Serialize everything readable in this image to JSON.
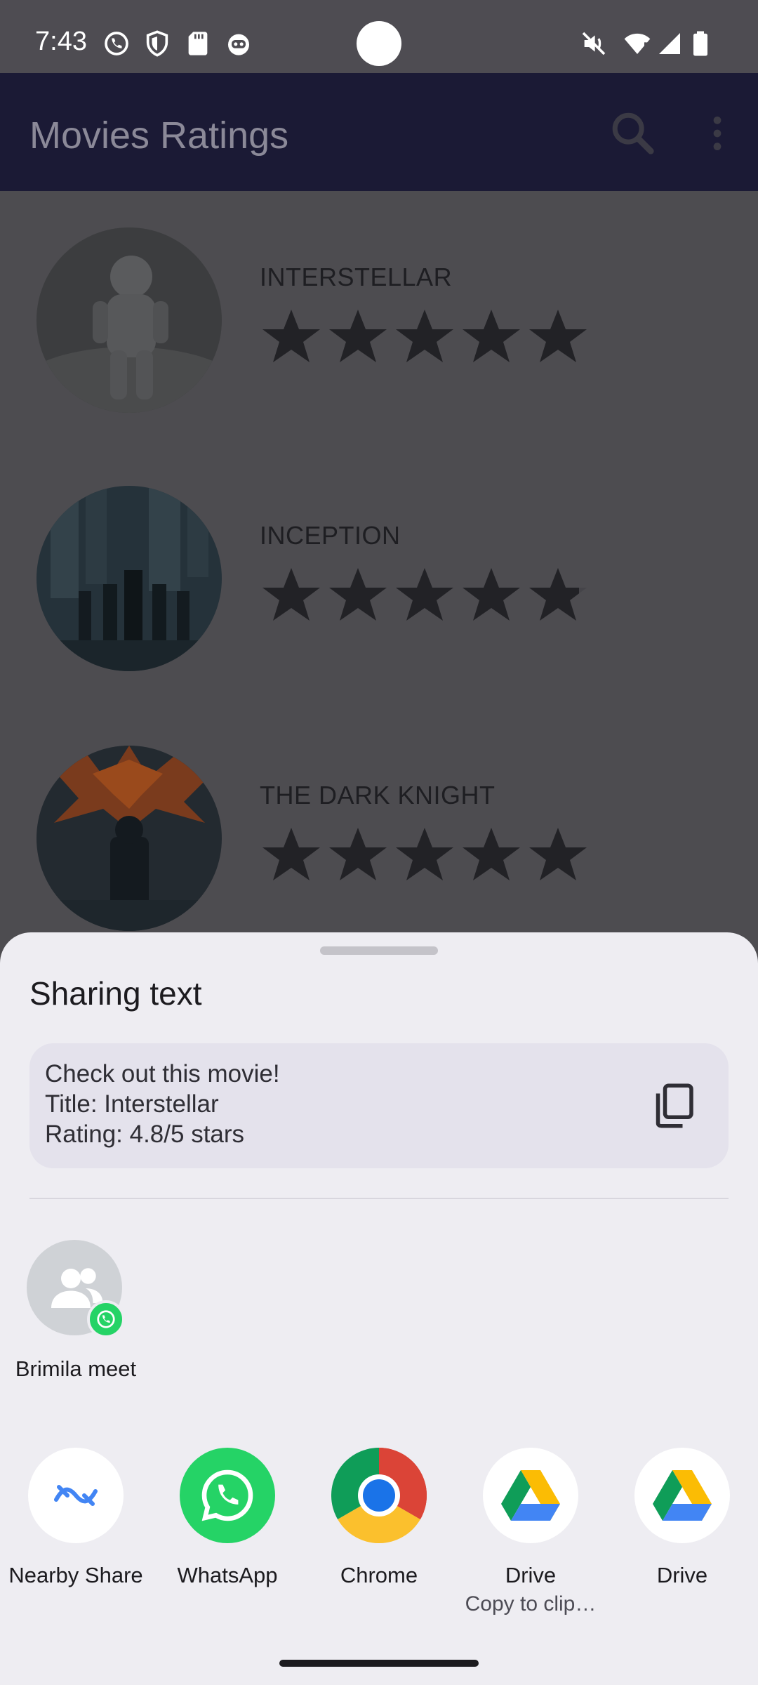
{
  "status_bar": {
    "time": "7:43"
  },
  "app_bar": {
    "title": "Movies Ratings"
  },
  "movies": [
    {
      "title": "INTERSTELLAR",
      "rating": 5
    },
    {
      "title": "INCEPTION",
      "rating": 4.8
    },
    {
      "title": "THE DARK KNIGHT",
      "rating": 5
    }
  ],
  "share_sheet": {
    "title": "Sharing text",
    "text_lines": [
      "Check out this movie!",
      "Title: Interstellar",
      "Rating: 4.8/5 stars"
    ],
    "contact": {
      "label": "Brimila meet"
    },
    "apps": [
      {
        "label": "Nearby Share",
        "sub": "",
        "icon": "nearby-share-icon"
      },
      {
        "label": "WhatsApp",
        "sub": "",
        "icon": "whatsapp-icon"
      },
      {
        "label": "Chrome",
        "sub": "",
        "icon": "chrome-icon"
      },
      {
        "label": "Drive",
        "sub": "Copy to clip…",
        "icon": "drive-icon"
      },
      {
        "label": "Drive",
        "sub": "",
        "icon": "drive-icon"
      }
    ]
  },
  "colors": {
    "app_bar": "#1b1a35",
    "scrim": "#4d4c50",
    "sheet": "#eeedf2",
    "whatsapp": "#25d366"
  }
}
